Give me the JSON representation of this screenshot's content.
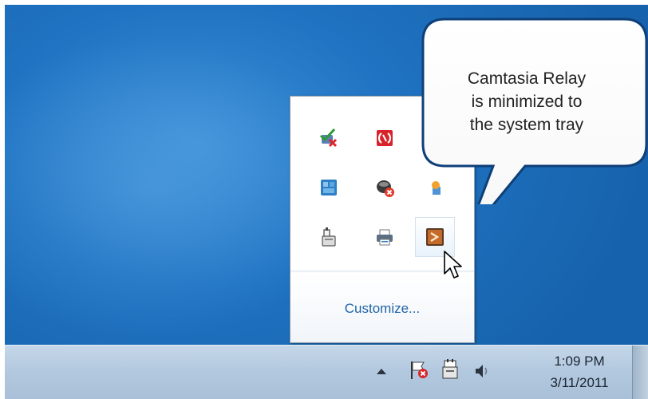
{
  "callout": {
    "line1": "Camtasia Relay",
    "line2": "is minimized to",
    "line3": "the system tray"
  },
  "tray_popup": {
    "customize_label": "Customize...",
    "icons": [
      {
        "name": "network-check-icon"
      },
      {
        "name": "adobe-updater-icon"
      },
      {
        "name": "partial-orange-icon"
      },
      {
        "name": "blue-tile-app-icon"
      },
      {
        "name": "disconnected-drive-icon"
      },
      {
        "name": "sync-app-icon"
      },
      {
        "name": "usb-device-icon"
      },
      {
        "name": "printer-icon"
      },
      {
        "name": "camtasia-relay-icon"
      }
    ]
  },
  "taskbar": {
    "clock_time": "1:09 PM",
    "clock_date": "3/11/2011",
    "icons": [
      "show-hidden-icons-arrow",
      "action-center-flag-icon",
      "power-plug-icon",
      "volume-icon"
    ]
  },
  "colors": {
    "desktop": "#1f73c2",
    "link": "#1f64a8",
    "taskbar": "#b2c8de"
  }
}
